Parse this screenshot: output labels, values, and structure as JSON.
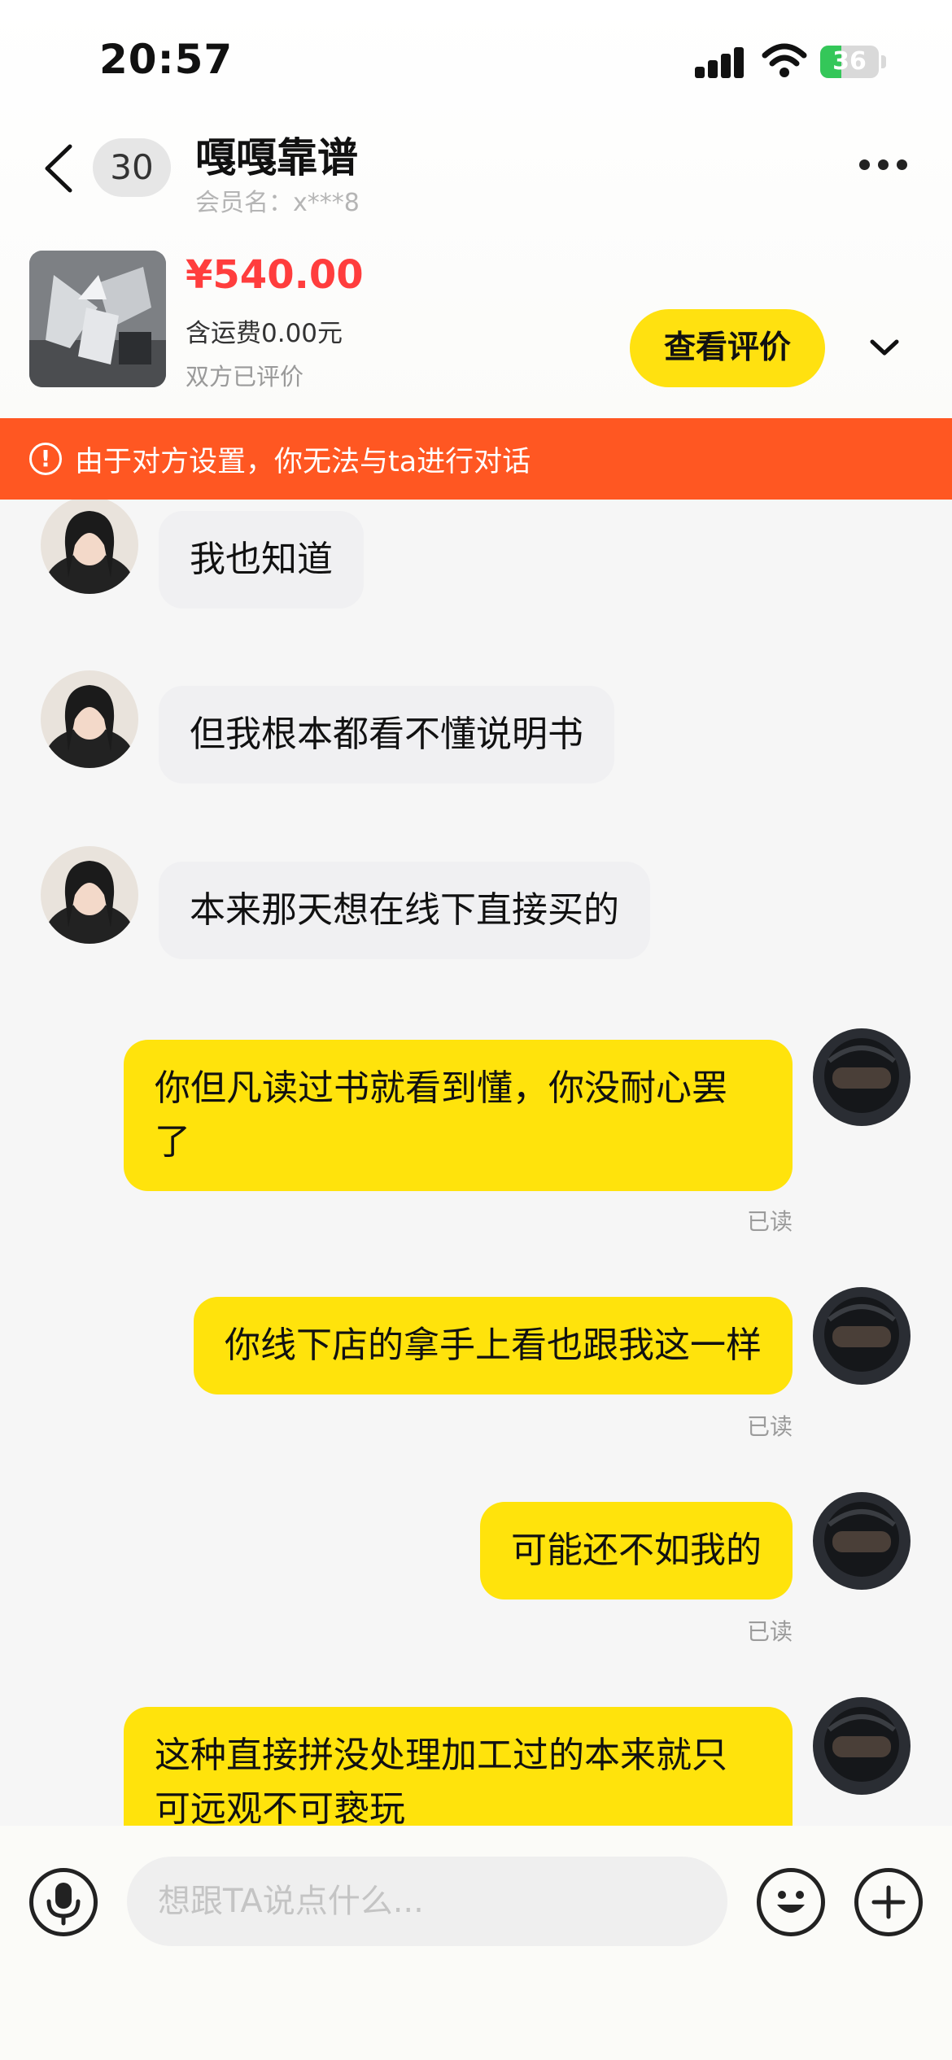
{
  "status_bar": {
    "time": "20:57",
    "battery": "36",
    "battery_level": 0.36
  },
  "header": {
    "unread_count": "30",
    "seller_name": "嘎嘎靠谱",
    "member_label": "会员名：x***8"
  },
  "product": {
    "price": "¥540.00",
    "shipping": "含运费0.00元",
    "review_status": "双方已评价",
    "review_button": "查看评价"
  },
  "warning": {
    "text": "由于对方设置，你无法与ta进行对话"
  },
  "messages": [
    {
      "side": "left",
      "text": "我也知道"
    },
    {
      "side": "left",
      "text": "但我根本都看不懂说明书"
    },
    {
      "side": "left",
      "text": "本来那天想在线下直接买的"
    },
    {
      "side": "right",
      "text": "你但凡读过书就看到懂，你没耐心罢了",
      "status": "已读"
    },
    {
      "side": "right",
      "text": "你线下店的拿手上看也跟我这一样",
      "status": "已读"
    },
    {
      "side": "right",
      "text": "可能还不如我的",
      "status": "已读"
    },
    {
      "side": "right",
      "text": "这种直接拼没处理加工过的本来就只可远观不可亵玩"
    }
  ],
  "input": {
    "placeholder": "想跟TA说点什么..."
  },
  "colors": {
    "accent_yellow": "#ffe30c",
    "warning_orange": "#ff5722",
    "price_red": "#ff3d3d"
  },
  "icons": {
    "back": "chevron-left-icon",
    "more": "more-icon",
    "collapse": "chevron-down-icon",
    "warning": "alert-circle-icon",
    "mic": "microphone-icon",
    "emoji": "emoji-icon",
    "plus": "plus-icon"
  }
}
